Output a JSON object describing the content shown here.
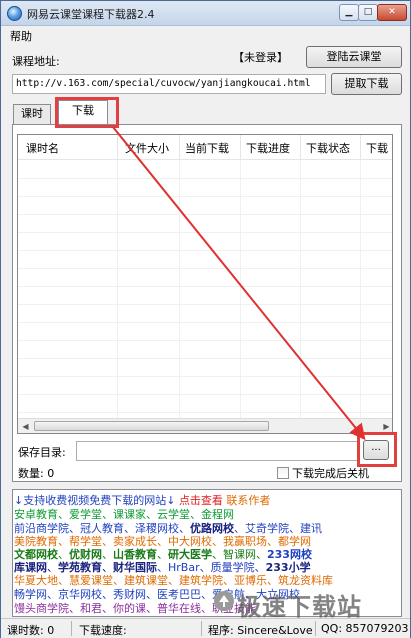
{
  "window": {
    "title": "网易云课堂课程下载器2.4"
  },
  "title_buttons": {
    "minimize": "▁",
    "maximize": "□",
    "close": "✕"
  },
  "menu": {
    "help": "帮助"
  },
  "course": {
    "address_label": "课程地址:",
    "login_status": "【未登录】",
    "login_button": "登陆云课堂",
    "url": "http://v.163.com/special/cuvocw/yanjiangkoucai.html",
    "extract_button": "提取下载"
  },
  "tabs": [
    {
      "label": "课时",
      "active": false
    },
    {
      "label": "下载",
      "active": true
    }
  ],
  "download_list": {
    "columns": [
      "课时名",
      "文件大小",
      "当前下载",
      "下载进度",
      "下载状态",
      "下载"
    ]
  },
  "save": {
    "label": "保存目录:",
    "path": "",
    "browse_button": "...",
    "count_label": "数量: 0",
    "shutdown_label": "下载完成后关机"
  },
  "ads": {
    "line1": [
      {
        "text": "↓支持收费视频免费下载的网站↓ ",
        "color": "c-blue"
      },
      {
        "text": "点击查看",
        "color": "c-red"
      },
      {
        "text": " 联系作者",
        "color": "c-orange"
      }
    ],
    "line2": [
      {
        "text": "安卓教育、爱学堂、课课家、云学堂、金程网",
        "color": "c-green"
      }
    ],
    "line3": [
      {
        "text": "前沿商学院、冠人教育、泽稷网校、",
        "color": "c-blue"
      },
      {
        "text": "优路网校",
        "color": "c-navy b"
      },
      {
        "text": "、艾奇学院、建讯",
        "color": "c-blue"
      }
    ],
    "line4": [
      {
        "text": "美院教育、帮学堂、卖家成长、中大网校、我赢职场、都学网",
        "color": "c-orange"
      }
    ],
    "line5": [
      {
        "text": "文都网校",
        "color": "c-dgreen b"
      },
      {
        "text": "、",
        "color": "c-dgreen"
      },
      {
        "text": "优财网",
        "color": "c-dgreen b"
      },
      {
        "text": "、",
        "color": "c-dgreen"
      },
      {
        "text": "山香教育",
        "color": "c-dgreen b"
      },
      {
        "text": "、",
        "color": "c-dgreen"
      },
      {
        "text": "研大医学",
        "color": "c-dgreen b"
      },
      {
        "text": "、智课网、",
        "color": "c-dgreen"
      },
      {
        "text": "233网校",
        "color": "c-blue b"
      }
    ],
    "line6": [
      {
        "text": "库课网",
        "color": "c-navy b"
      },
      {
        "text": "、",
        "color": "c-navy"
      },
      {
        "text": "学苑教育",
        "color": "c-navy b"
      },
      {
        "text": "、",
        "color": "c-navy"
      },
      {
        "text": "财华国际",
        "color": "c-navy b"
      },
      {
        "text": "、HrBar、质量学院、",
        "color": "c-blue"
      },
      {
        "text": "233小学",
        "color": "c-navy b"
      }
    ],
    "line7": [
      {
        "text": "华夏大地、慧爱课堂、建筑课堂、建筑学院、亚博乐、筑龙资料库",
        "color": "c-orange"
      }
    ],
    "line8": [
      {
        "text": "畅学网、京华网校、秀财网、医考巴巴、爱启航、大立网校",
        "color": "c-blue"
      }
    ],
    "line9": [
      {
        "text": "馒头商学院、和君、你的课、普华在线、职业技能",
        "color": "c-purple"
      }
    ]
  },
  "status": {
    "lessons": "课时数: 0",
    "speed": "下载速度:",
    "program": "程序: Sincere&Love",
    "qq": "QQ: 857079203"
  },
  "watermark": {
    "text": "极速下载站"
  }
}
